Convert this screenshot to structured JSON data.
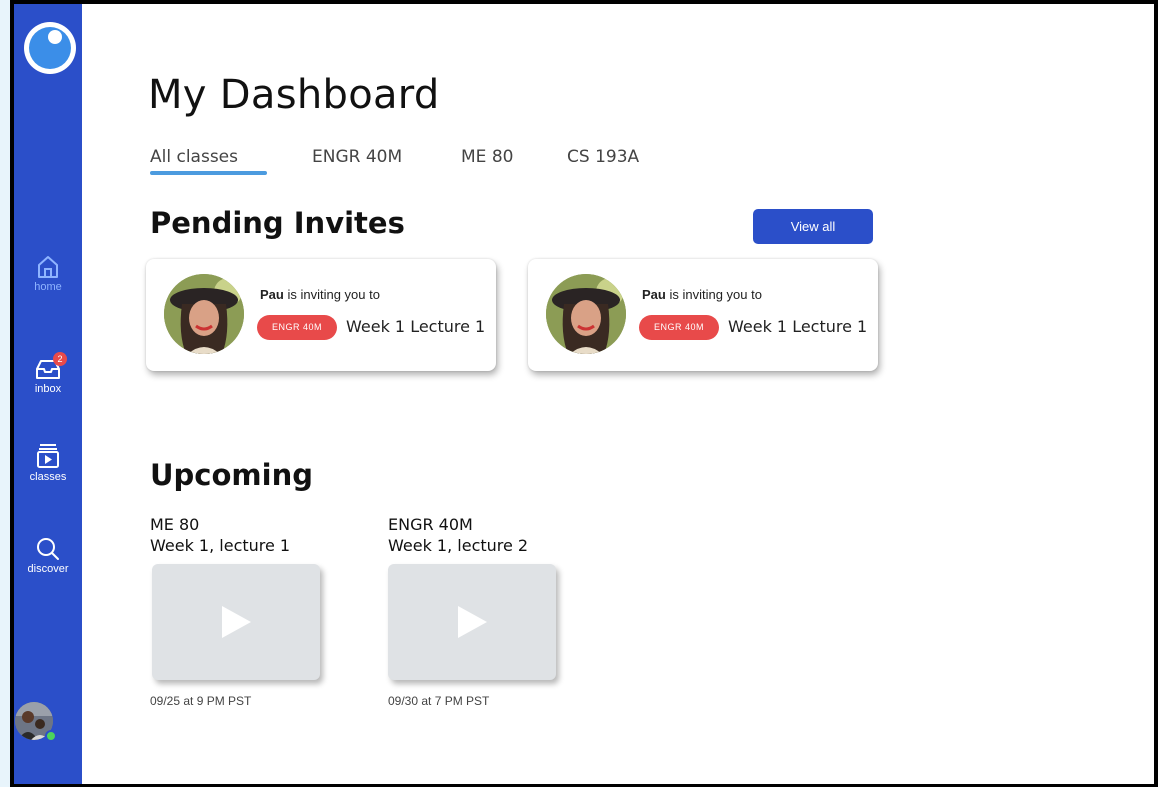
{
  "page": {
    "title": "My Dashboard"
  },
  "tabs": [
    "All classes",
    "ENGR 40M",
    "ME 80",
    "CS 193A"
  ],
  "sidebar": {
    "home_label": "home",
    "inbox_label": "inbox",
    "inbox_badge": "2",
    "classes_label": "classes",
    "discover_label": "discover"
  },
  "pending": {
    "title": "Pending Invites",
    "view_all": "View all",
    "invites": [
      {
        "sender": "Pau",
        "text": " is inviting you to",
        "course": "ENGR 40M",
        "lecture": "Week 1 Lecture 1"
      },
      {
        "sender": "Pau",
        "text": " is inviting you to",
        "course": "ENGR 40M",
        "lecture": "Week 1 Lecture 1"
      }
    ]
  },
  "upcoming": {
    "title": "Upcoming",
    "items": [
      {
        "course": "ME 80",
        "lecture": "Week 1, lecture 1",
        "time": "09/25 at 9 PM PST"
      },
      {
        "course": "ENGR 40M",
        "lecture": "Week 1, lecture 2",
        "time": "09/30 at 7 PM PST"
      }
    ]
  },
  "colors": {
    "sidebar": "#2b4fc9",
    "accent": "#4c9bdf",
    "course_pill": "#e84a4a",
    "online": "#4cd35c"
  }
}
